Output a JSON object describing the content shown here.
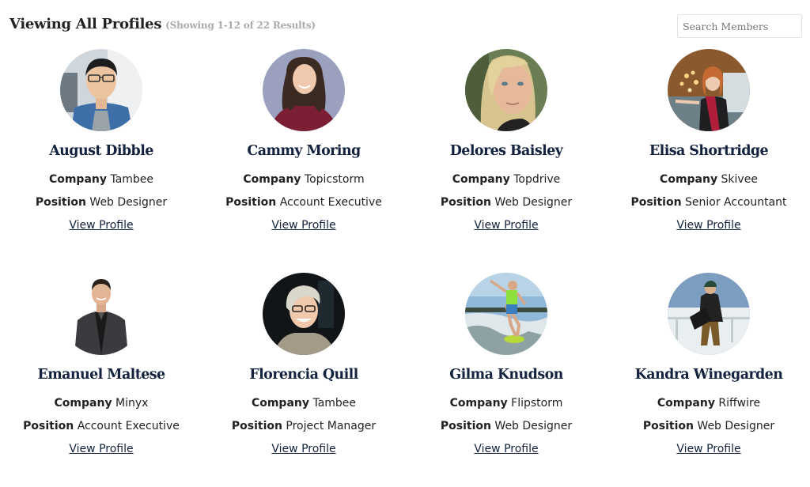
{
  "header": {
    "title": "Viewing All Profiles",
    "result_count": "(Showing 1-12 of 22 Results)"
  },
  "search": {
    "placeholder": "Search Members",
    "value": ""
  },
  "labels": {
    "company": "Company",
    "position": "Position",
    "view_profile": "View Profile"
  },
  "colors": {
    "name_color": "#13233f",
    "muted_text": "#aaaaaa"
  },
  "members": [
    {
      "name": "August Dibble",
      "company": "Tambee",
      "position": "Web Designer",
      "avatar": "avatar-man-glasses-denim-shirt"
    },
    {
      "name": "Cammy Moring",
      "company": "Topicstorm",
      "position": "Account Executive",
      "avatar": "avatar-woman-brown-hair-maroon-top"
    },
    {
      "name": "Delores Baisley",
      "company": "Topdrive",
      "position": "Web Designer",
      "avatar": "avatar-woman-blonde-closeup"
    },
    {
      "name": "Elisa Shortridge",
      "company": "Skivee",
      "position": "Senior Accountant",
      "avatar": "avatar-woman-red-hair-scarf"
    },
    {
      "name": "Emanuel Maltese",
      "company": "Minyx",
      "position": "Account Executive",
      "avatar": "avatar-man-dark-suit"
    },
    {
      "name": "Florencia Quill",
      "company": "Tambee",
      "position": "Project Manager",
      "avatar": "avatar-woman-short-blonde-glasses"
    },
    {
      "name": "Gilma Knudson",
      "company": "Flipstorm",
      "position": "Web Designer",
      "avatar": "avatar-wakeboarder"
    },
    {
      "name": "Kandra Winegarden",
      "company": "Riffwire",
      "position": "Web Designer",
      "avatar": "avatar-snowboarder"
    }
  ]
}
